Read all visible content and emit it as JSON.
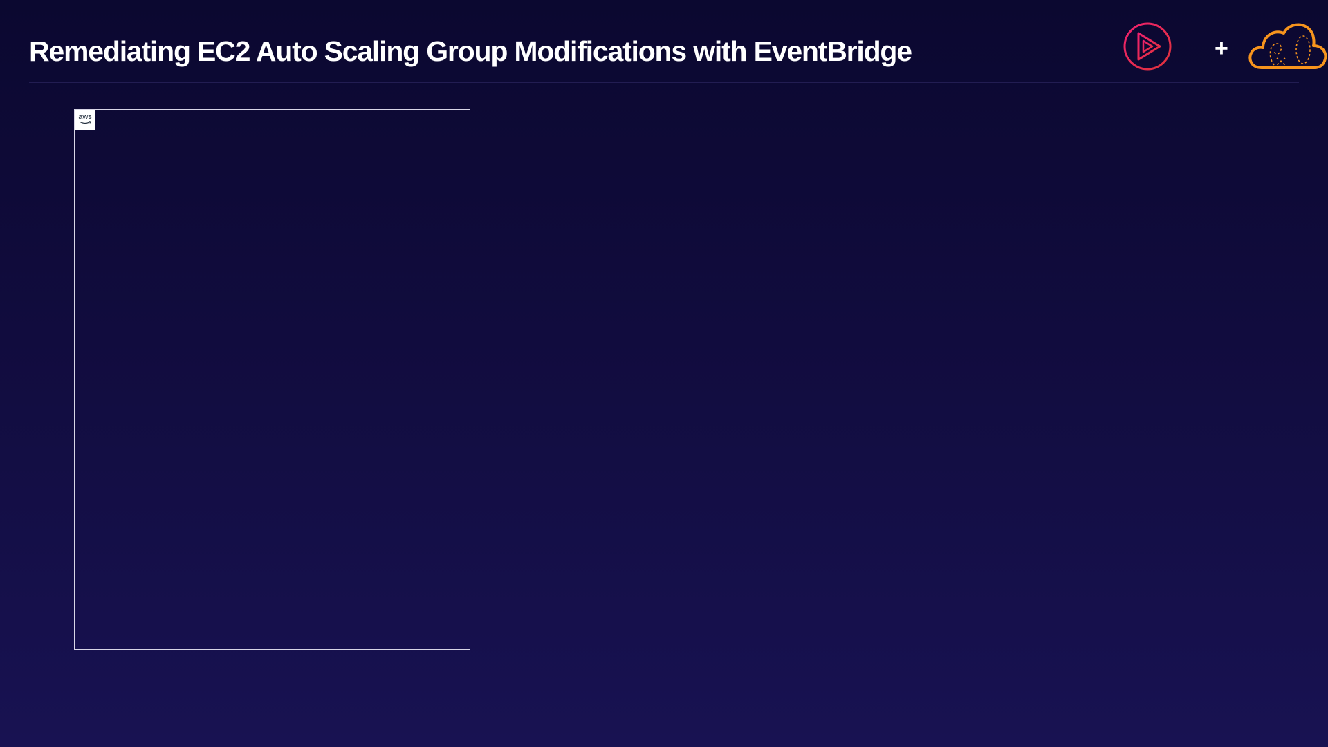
{
  "header": {
    "title": "Remediating EC2 Auto Scaling Group Modifications with EventBridge",
    "plus": "+"
  },
  "logos": {
    "play_icon": "pluralsight-play-icon",
    "cloud_icon": "acloudguru-cloud-icon",
    "play_color": "#e0194f",
    "cloud_color": "#f7941d"
  },
  "diagram": {
    "aws_badge": "aws",
    "aws_icon": "aws-logo-icon",
    "frame_color": "#d8d6e6"
  }
}
